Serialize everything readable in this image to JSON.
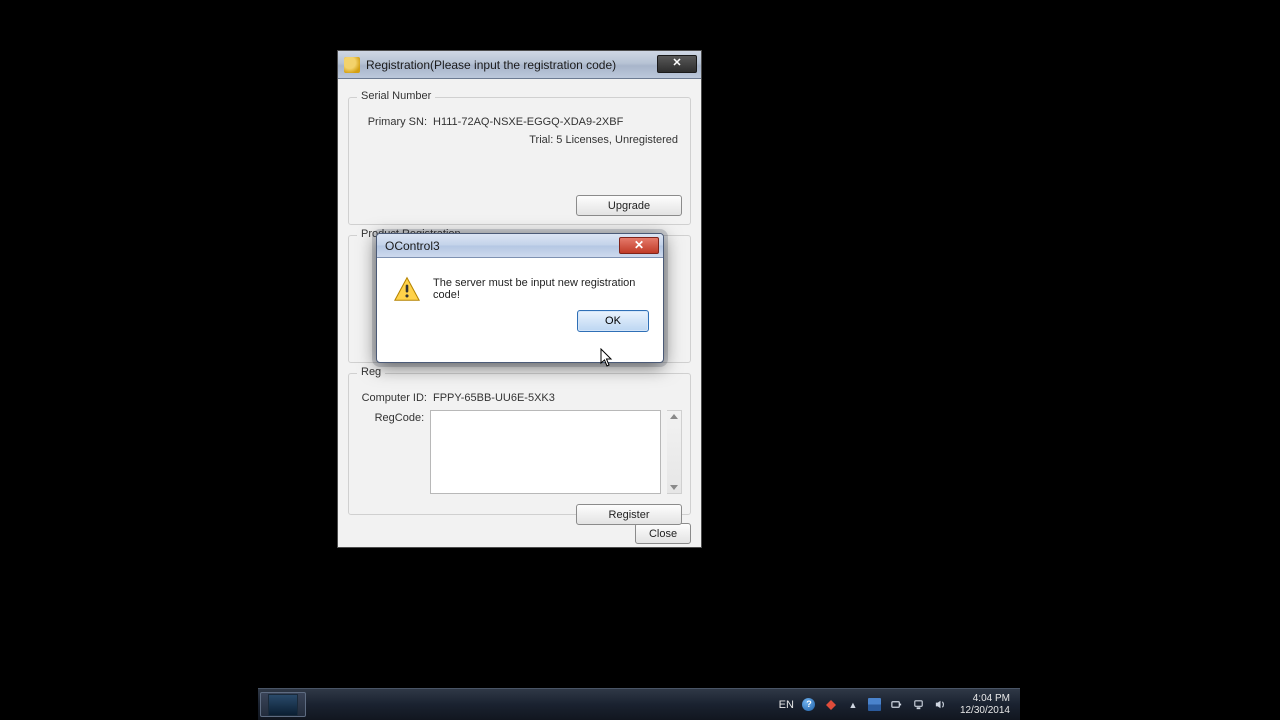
{
  "window": {
    "title": "Registration(Please input the registration code)",
    "close_x": "✕"
  },
  "serial": {
    "group_title": "Serial Number",
    "primary_label": "Primary SN:",
    "primary_value": "H111-72AQ-NSXE-EGGQ-XDA9-2XBF",
    "status": "Trial: 5 Licenses, Unregistered",
    "upgrade_label": "Upgrade"
  },
  "product": {
    "group_title": "Product Registration"
  },
  "manual": {
    "group_title": "Reg",
    "computer_label": "Computer ID:",
    "computer_value": "FPPY-65BB-UU6E-5XK3",
    "regcode_label": "RegCode:",
    "regcode_value": "",
    "register_label": "Register"
  },
  "footer": {
    "close_label": "Close"
  },
  "msgbox": {
    "title": "OControl3",
    "close_x": "✕",
    "message": "The server must be input new registration code!",
    "ok_label": "OK"
  },
  "taskbar": {
    "lang": "EN",
    "time": "4:04 PM",
    "date": "12/30/2014"
  }
}
